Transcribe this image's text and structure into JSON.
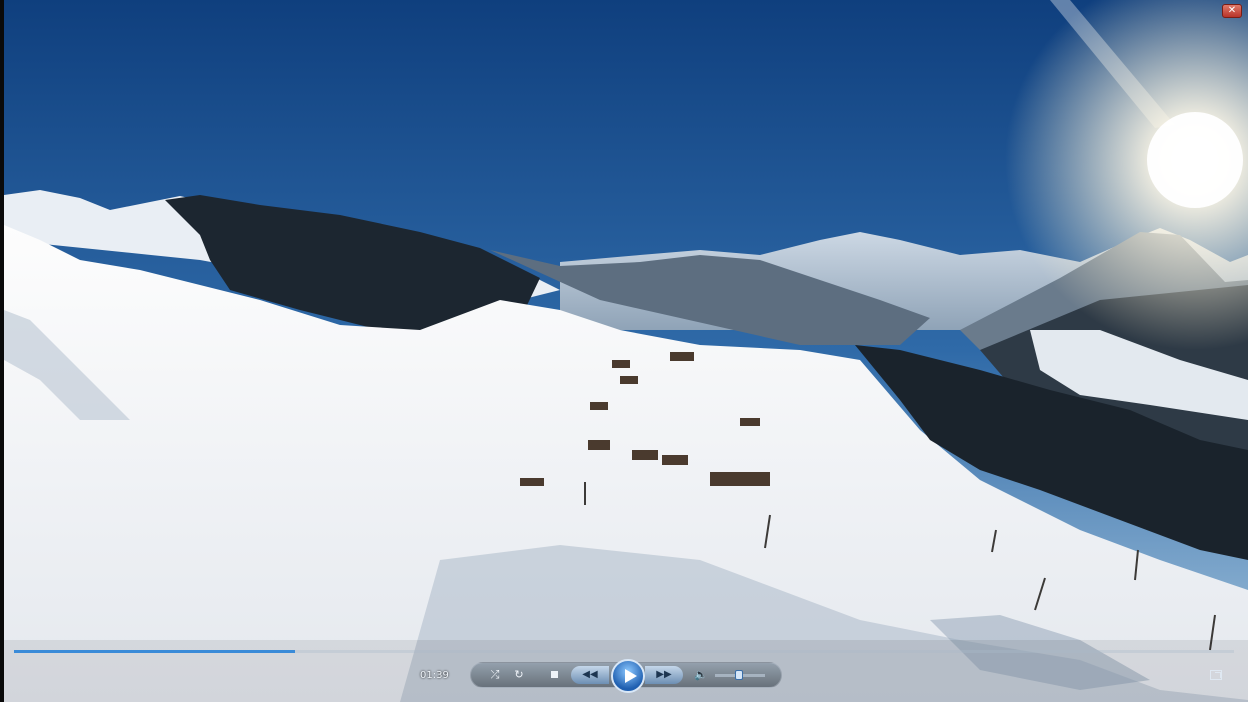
{
  "player": {
    "close_label": "✕",
    "seek": {
      "progress": 0.23
    },
    "time": "01:39",
    "controls": {
      "shuffle_icon": "shuffle-icon",
      "repeat_icon": "repeat-icon",
      "stop_icon": "stop-icon",
      "prev_icon": "previous-icon",
      "play_icon": "play-icon",
      "next_icon": "next-icon",
      "mute_icon": "speaker-icon"
    },
    "volume": {
      "level": 0.4
    },
    "accent_color": "#3a8bd8"
  }
}
